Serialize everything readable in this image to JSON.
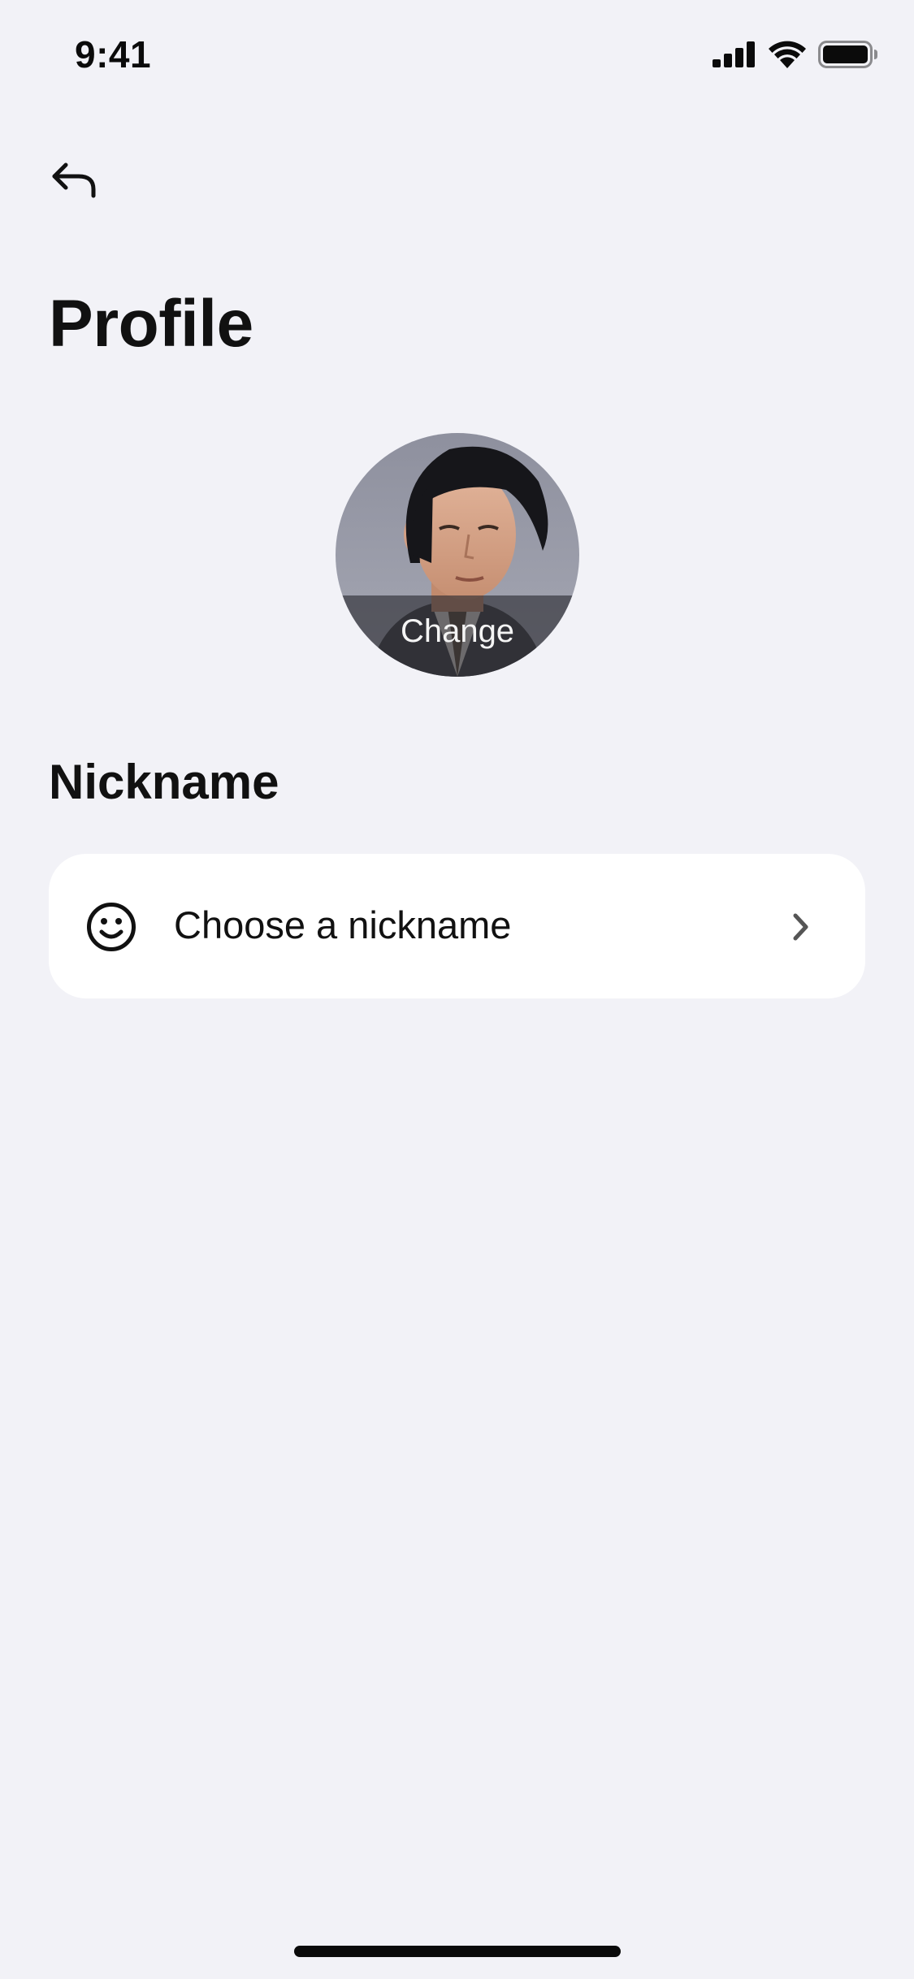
{
  "status_bar": {
    "time": "9:41",
    "icons": [
      "cellular-signal-icon",
      "wifi-icon",
      "battery-icon"
    ]
  },
  "nav": {
    "back_icon": "back-arrow-icon"
  },
  "page": {
    "title": "Profile"
  },
  "avatar": {
    "change_label": "Change"
  },
  "nickname_section": {
    "heading": "Nickname",
    "row_label": "Choose a nickname",
    "row_icon": "smiley-face-icon",
    "row_trailing_icon": "chevron-right-icon"
  },
  "colors": {
    "background": "#f2f2f7",
    "card": "#ffffff",
    "text": "#111111",
    "chevron": "#555555"
  }
}
